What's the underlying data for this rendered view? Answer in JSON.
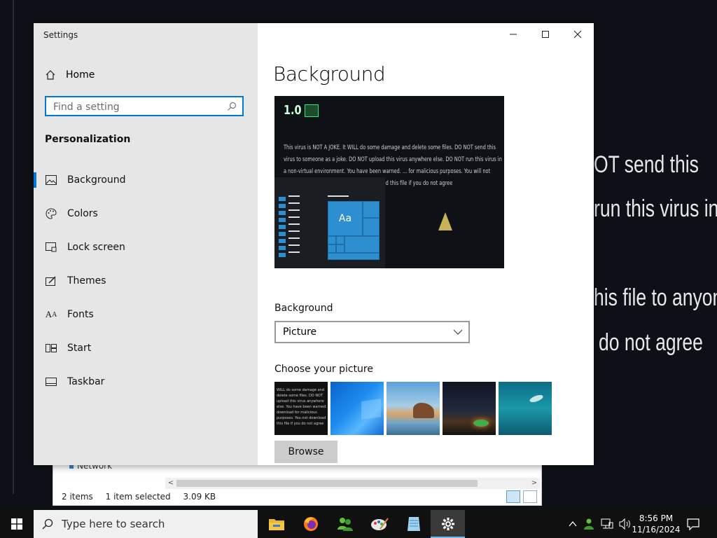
{
  "desktop": {
    "lines": [
      "OT send this",
      "run this virus in a",
      "his file to anyone",
      "do not agree"
    ]
  },
  "explorer": {
    "nav_item": "Network",
    "status": {
      "items": "2 items",
      "selected": "1 item selected",
      "size": "3.09 KB"
    }
  },
  "window": {
    "title": "Settings"
  },
  "sidebar": {
    "home": "Home",
    "search_placeholder": "Find a setting",
    "section": "Personalization",
    "items": [
      {
        "label": "Background",
        "icon": "picture-icon",
        "active": true
      },
      {
        "label": "Colors",
        "icon": "palette-icon"
      },
      {
        "label": "Lock screen",
        "icon": "lock-screen-icon"
      },
      {
        "label": "Themes",
        "icon": "themes-icon"
      },
      {
        "label": "Fonts",
        "icon": "fonts-icon"
      },
      {
        "label": "Start",
        "icon": "start-icon"
      },
      {
        "label": "Taskbar",
        "icon": "taskbar-icon"
      }
    ]
  },
  "content": {
    "title": "Background",
    "preview": {
      "version": "1.0",
      "text": "This virus is NOT A JOKE. It WILL do some damage and delete some files. DO NOT send this virus to someone as a joke. DO NOT upload this virus anywhere else. DO NOT run this virus in a non-virtual environment. You have been warned. ... for malicious purposes. You will not send this file to anyone ... may not download this file if you do not agree",
      "tile_label": "Aa"
    },
    "background_label": "Background",
    "background_value": "Picture",
    "choose_label": "Choose your picture",
    "thumb1_text": "WILL do some damage and delete some files. DO NOT upload this virus anywhere else. You have been warned. download for malicious purposes. You not download this file if you do not agree",
    "browse": "Browse"
  },
  "taskbar": {
    "search_placeholder": "Type here to search",
    "apps": [
      "file-explorer-icon",
      "firefox-icon",
      "people-icon",
      "paint-icon",
      "notepad-icon",
      "settings-icon"
    ],
    "time": "8:56 PM",
    "date": "11/16/2024"
  },
  "colors": {
    "accent": "#0078d7",
    "taskbar": "#101010",
    "sidebar": "#e6e6e6"
  }
}
